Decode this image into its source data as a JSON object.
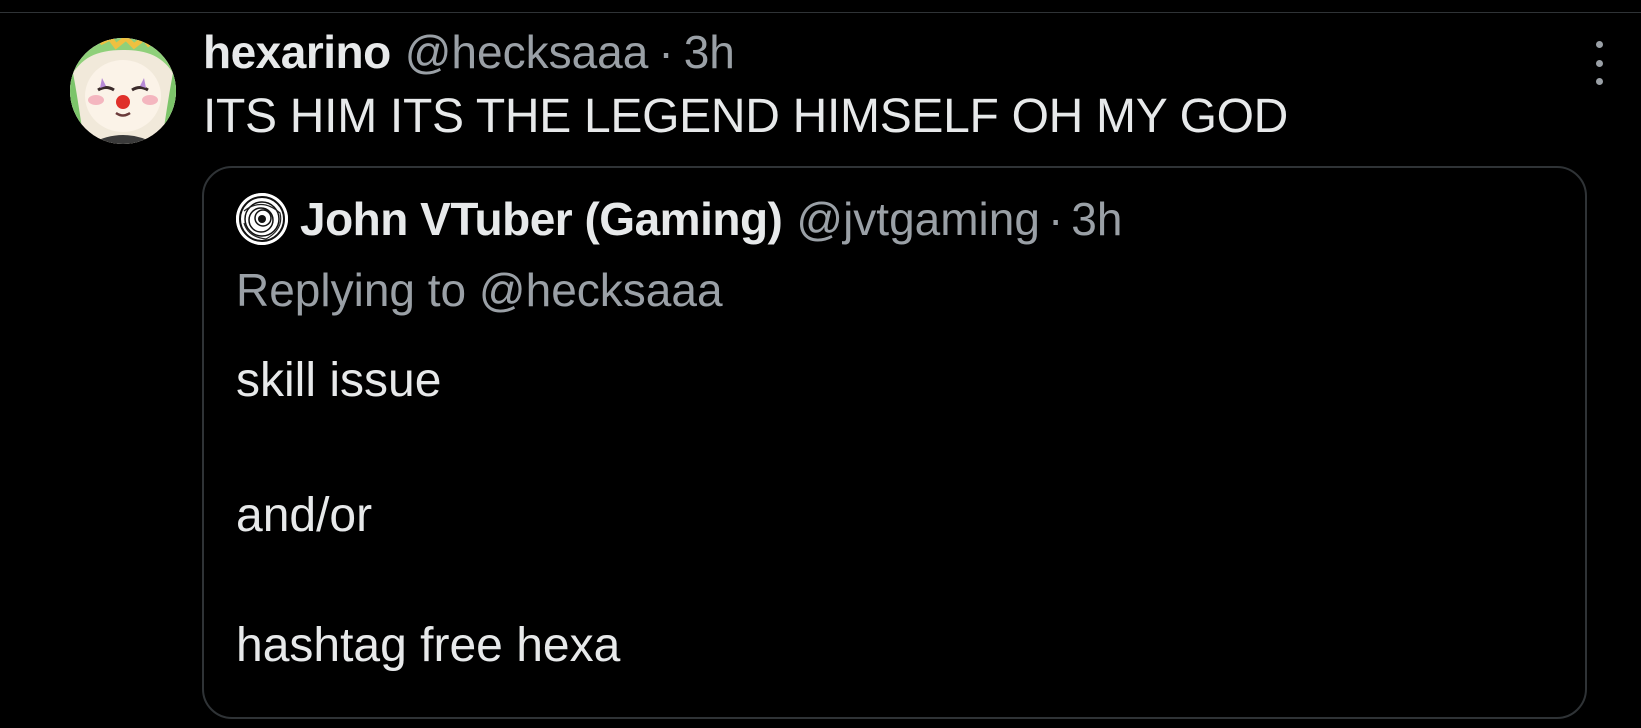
{
  "tweet": {
    "author_name": "hexarino",
    "author_handle": "@hecksaaa",
    "separator": "·",
    "timestamp": "3h",
    "text": "ITS HIM ITS THE LEGEND HIMSELF OH MY GOD",
    "avatar_icon": "clown-girl-avatar",
    "more_icon": "more-vertical-icon"
  },
  "quote": {
    "author_name": "John VTuber (Gaming)",
    "author_handle": "@jvtgaming",
    "separator": "·",
    "timestamp": "3h",
    "replying_prefix": "Replying to",
    "replying_handle": "@hecksaaa",
    "body_lines": [
      "skill issue",
      "and/or",
      "hashtag free hexa"
    ],
    "avatar_icon": "scribble-avatar"
  },
  "colors": {
    "background": "#000000",
    "primary_text": "#e7e9ea",
    "secondary_text": "#9aa0a6",
    "border": "#2f3336"
  }
}
